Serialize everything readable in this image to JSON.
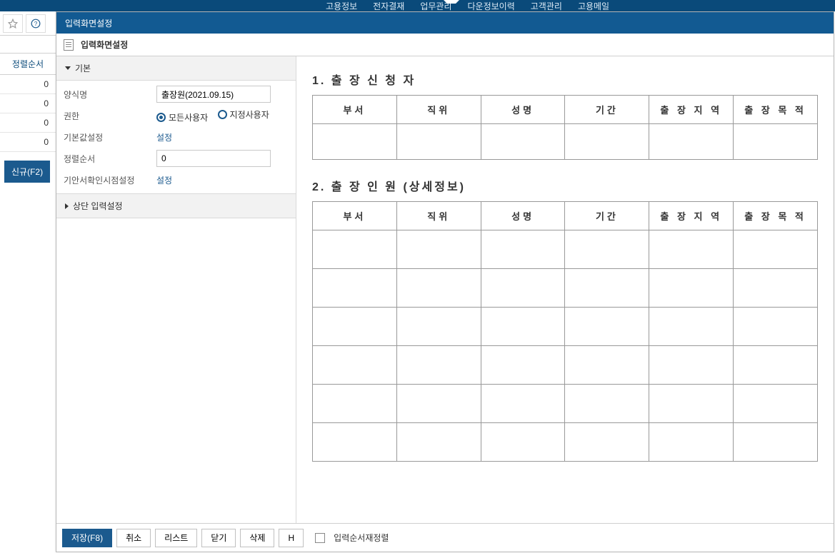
{
  "topnav": {
    "items": [
      "고용정보",
      "전자결재",
      "업무관리",
      "다운정보이력",
      "고객관리",
      "고용메일"
    ]
  },
  "bg": {
    "sort_header": "정렬순서",
    "rows": [
      "0",
      "0",
      "0",
      "0"
    ],
    "new_btn": "신규(F2)"
  },
  "dialog": {
    "title": "입력화면설정",
    "subtitle": "입력화면설정"
  },
  "props": {
    "group_basic": "기본",
    "group_top": "상단 입력설정",
    "form_name": {
      "label": "양식명",
      "value": "출장원(2021.09.15)"
    },
    "perm": {
      "label": "권한",
      "opt_all": "모든사용자",
      "opt_sel": "지정사용자"
    },
    "default_set": {
      "label": "기본값설정",
      "link": "설정"
    },
    "sort": {
      "label": "정렬순서",
      "value": "0"
    },
    "draft_set": {
      "label": "기안서확인시점설정",
      "link": "설정"
    }
  },
  "preview": {
    "section1": "1. 출 장 신 청 자",
    "section2": "2. 출 장 인 원 (상세정보)",
    "cols": [
      "부서",
      "직위",
      "성명",
      "기간",
      "출 장 지 역",
      "출 장 목 적"
    ]
  },
  "footer": {
    "save": "저장(F8)",
    "cancel": "취소",
    "list": "리스트",
    "close": "닫기",
    "delete": "삭제",
    "h": "H",
    "chk_label": "입력순서재정렬"
  }
}
